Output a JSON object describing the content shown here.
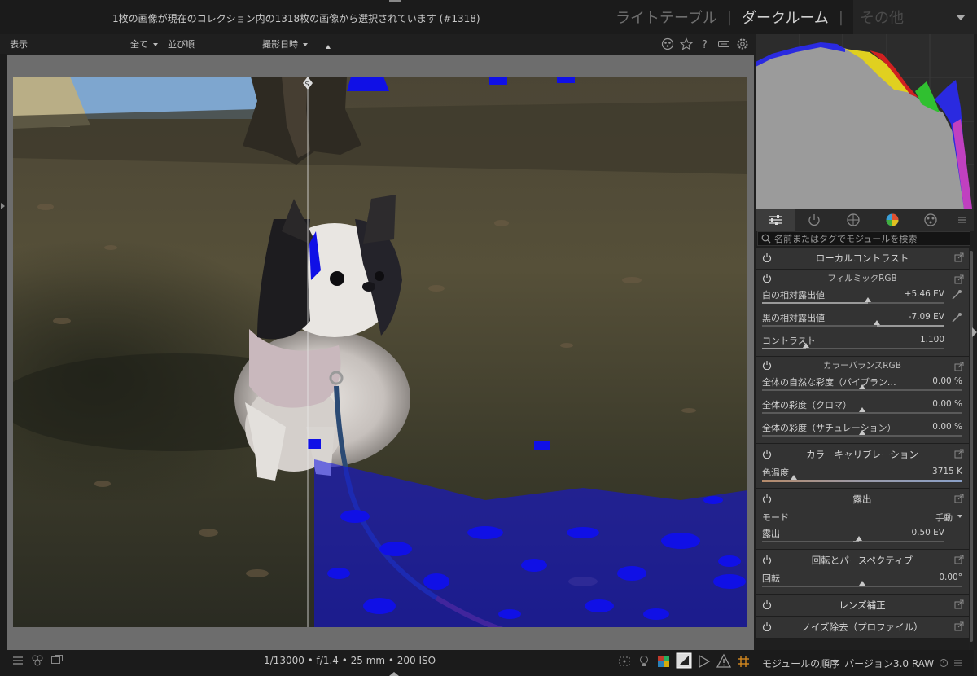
{
  "topbar": {
    "collection_info": "1枚の画像が現在のコレクション内の1318枚の画像から選択されています (#1318)",
    "views": [
      "ライトテーブル",
      "ダークルーム"
    ],
    "view_other": "その他"
  },
  "filterbar": {
    "display": "表示",
    "filter_all": "全て",
    "sort_label": "並び順",
    "sort_value": "撮影日時"
  },
  "photo": {
    "split_marker": "S"
  },
  "bottombar": {
    "exif": "1/13000 • f/1.4 • 25 mm • 200 ISO"
  },
  "right_panel": {
    "search_placeholder": "名前またはタグでモジュールを検索",
    "modules": {
      "local_contrast": {
        "title": "ローカルコントラスト"
      },
      "filmic": {
        "title": "フィルミックRGB",
        "white_label": "白の相対露出値",
        "white_value": "+5.46 EV",
        "white_pos": 0.58,
        "black_label": "黒の相対露出値",
        "black_value": "-7.09 EV",
        "black_pos": 0.63,
        "contrast_label": "コントラスト",
        "contrast_value": "1.100",
        "contrast_pos": 0.24
      },
      "color_balance": {
        "title": "カラーバランスRGB",
        "vibrance_label": "全体の自然な彩度（バイブランス）",
        "vibrance_value": "0.00 %",
        "chroma_label": "全体の彩度（クロマ）",
        "chroma_value": "0.00 %",
        "saturation_label": "全体の彩度（サチュレーション）",
        "saturation_value": "0.00 %"
      },
      "color_calibration": {
        "title": "カラーキャリブレーション",
        "temp_label": "色温度",
        "temp_value": "3715 K",
        "temp_pos": 0.16
      },
      "exposure": {
        "title": "露出",
        "mode_label": "モード",
        "mode_value": "手動",
        "exposure_label": "露出",
        "exposure_value": "0.50 EV",
        "exposure_pos": 0.53
      },
      "rotate": {
        "title": "回転とパースペクティブ",
        "rotate_label": "回転",
        "rotate_value": "0.00°"
      },
      "lens": {
        "title": "レンズ補正"
      },
      "denoise": {
        "title": "ノイズ除去（プロファイル）"
      }
    },
    "footer": {
      "order_label": "モジュールの順序",
      "order_value": "バージョン3.0 RAW"
    }
  }
}
